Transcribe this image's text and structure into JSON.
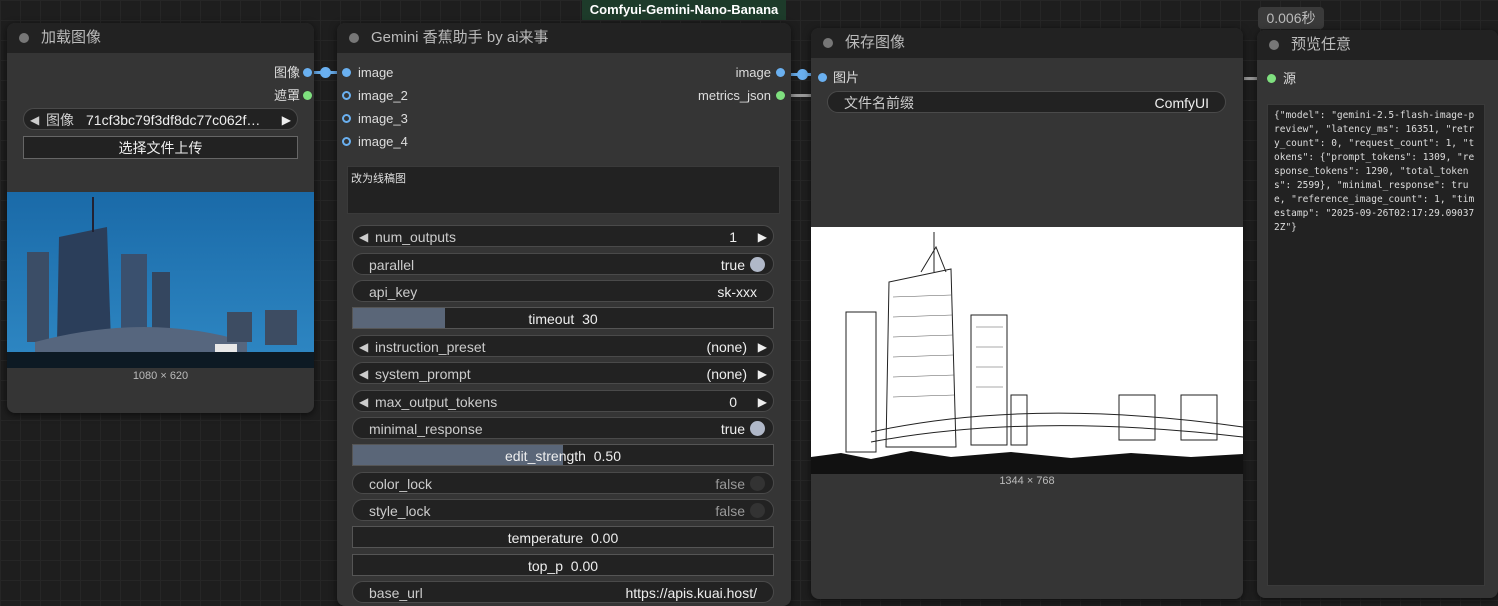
{
  "title_badge": "Comfyui-Gemini-Nano-Banana",
  "timing_badge": "0.006秒",
  "load_node": {
    "title": "加载图像",
    "out_image": "图像",
    "out_mask": "遮罩",
    "image_label": "图像",
    "image_value": "71cf3bc79f3df8dc77c062f…",
    "upload_button": "选择文件上传",
    "dimensions": "1080 × 620"
  },
  "gemini_node": {
    "title": "Gemini 香蕉助手 by ai来事",
    "inputs": [
      "image",
      "image_2",
      "image_3",
      "image_4"
    ],
    "outputs": [
      "image",
      "metrics_json"
    ],
    "prompt_text": "改为线稿图",
    "widgets": {
      "num_outputs": {
        "label": "num_outputs",
        "value": "1"
      },
      "parallel": {
        "label": "parallel",
        "value": "true"
      },
      "api_key": {
        "label": "api_key",
        "value": "sk-xxx"
      },
      "timeout": {
        "label": "timeout",
        "value": "30",
        "fill": 0.22
      },
      "instruction_preset": {
        "label": "instruction_preset",
        "value": "(none)"
      },
      "system_prompt": {
        "label": "system_prompt",
        "value": "(none)"
      },
      "max_output_tokens": {
        "label": "max_output_tokens",
        "value": "0"
      },
      "minimal_response": {
        "label": "minimal_response",
        "value": "true"
      },
      "edit_strength": {
        "label": "edit_strength",
        "value": "0.50",
        "fill": 0.5
      },
      "color_lock": {
        "label": "color_lock",
        "value": "false"
      },
      "style_lock": {
        "label": "style_lock",
        "value": "false"
      },
      "temperature": {
        "label": "temperature",
        "value": "0.00"
      },
      "top_p": {
        "label": "top_p",
        "value": "0.00"
      },
      "base_url": {
        "label": "base_url",
        "value": "https://apis.kuai.host/"
      }
    }
  },
  "save_node": {
    "title": "保存图像",
    "in_image": "图片",
    "prefix_label": "文件名前缀",
    "prefix_value": "ComfyUI",
    "dimensions": "1344 × 768"
  },
  "preview_node": {
    "title": "预览任意",
    "in_source": "源",
    "text": "{\"model\": \"gemini-2.5-flash-image-preview\", \"latency_ms\": 16351, \"retry_count\": 0, \"request_count\": 1, \"tokens\": {\"prompt_tokens\": 1309, \"response_tokens\": 1290, \"total_tokens\": 2599}, \"minimal_response\": true, \"reference_image_count\": 1, \"timestamp\": \"2025-09-26T02:17:29.090372Z\"}"
  },
  "colors": {
    "link_image": "#6ab0f0",
    "link_json": "#7fe07f",
    "node_bg": "#353535",
    "title_bg": "#222222"
  }
}
